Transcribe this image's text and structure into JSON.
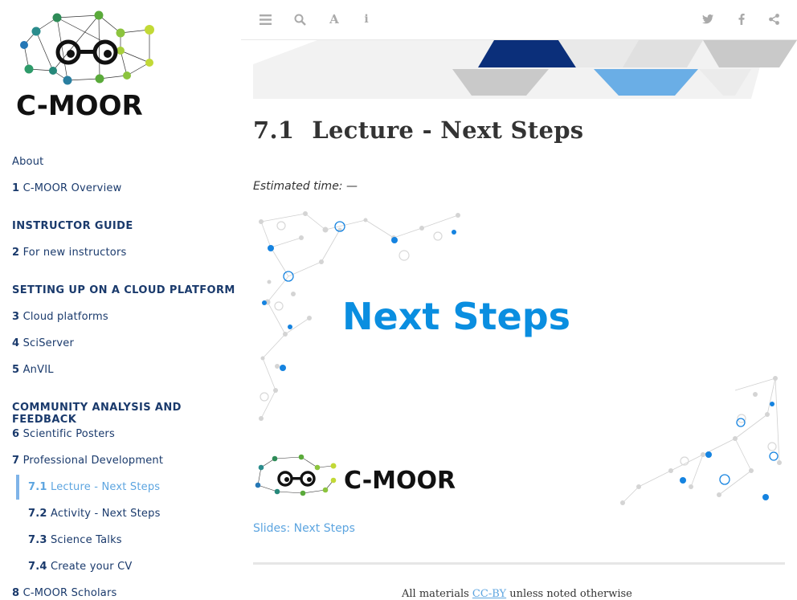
{
  "sidebar": {
    "logo_text": "C-MOOR",
    "items": [
      {
        "type": "item",
        "num": "",
        "label": "About"
      },
      {
        "type": "item",
        "num": "1",
        "label": "C-MOOR Overview"
      },
      {
        "type": "head",
        "label": "INSTRUCTOR GUIDE"
      },
      {
        "type": "item",
        "num": "2",
        "label": "For new instructors"
      },
      {
        "type": "head",
        "label": "SETTING UP ON A CLOUD PLATFORM"
      },
      {
        "type": "item",
        "num": "3",
        "label": "Cloud platforms"
      },
      {
        "type": "item",
        "num": "4",
        "label": "SciServer"
      },
      {
        "type": "item",
        "num": "5",
        "label": "AnVIL"
      },
      {
        "type": "head",
        "label": "COMMUNITY ANALYSIS AND FEEDBACK"
      },
      {
        "type": "item",
        "num": "6",
        "label": "Scientific Posters"
      },
      {
        "type": "item",
        "num": "7",
        "label": "Professional Development"
      },
      {
        "type": "sub",
        "num": "7.1",
        "label": "Lecture - Next Steps",
        "active": true
      },
      {
        "type": "sub",
        "num": "7.2",
        "label": "Activity - Next Steps"
      },
      {
        "type": "sub",
        "num": "7.3",
        "label": "Science Talks"
      },
      {
        "type": "sub",
        "num": "7.4",
        "label": "Create your CV"
      },
      {
        "type": "item",
        "num": "8",
        "label": "C-MOOR Scholars"
      }
    ]
  },
  "toolbar": {
    "left_icons": [
      "menu-icon",
      "search-icon",
      "font-icon",
      "info-icon"
    ],
    "right_icons": [
      "twitter-icon",
      "facebook-icon",
      "share-icon"
    ]
  },
  "main": {
    "section_number": "7.1",
    "title": "Lecture - Next Steps",
    "estimated_time": "Estimated time: —",
    "slide_title": "Next Steps",
    "slide_logo_text": "C-MOOR",
    "slides_link": "Slides: Next Steps",
    "footer_before": "All materials ",
    "footer_link": "CC-BY",
    "footer_after": " unless noted otherwise"
  },
  "colors": {
    "nav_text": "#1a3a6c",
    "accent": "#5da5e0",
    "slide_title": "#0a8ee0",
    "banner_dark": "#0b2f7a",
    "banner_light": "#6aaee6"
  }
}
